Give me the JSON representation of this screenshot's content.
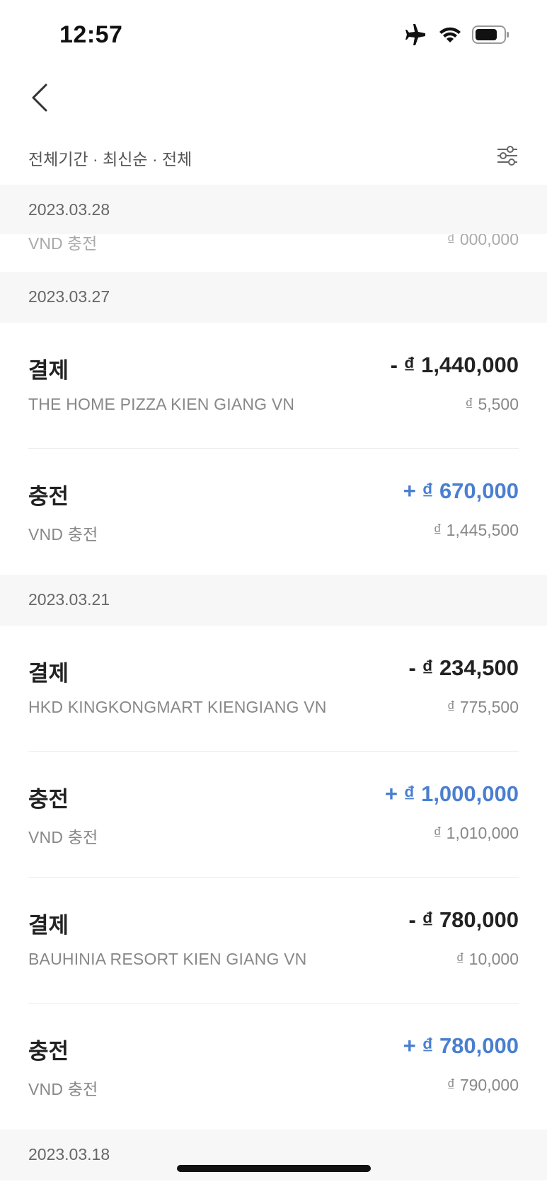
{
  "status_bar": {
    "time": "12:57",
    "icons": [
      "airplane-icon",
      "wifi-icon",
      "battery-icon"
    ]
  },
  "nav": {
    "back_icon": "chevron-left-icon"
  },
  "filter": {
    "label": "전체기간 · 최신순 · 전체",
    "icon": "sliders-icon"
  },
  "sticky_date": "2023.03.28",
  "partial_row": {
    "left": "VND 충전",
    "right": "₫ 000,000"
  },
  "groups": [
    {
      "date": "2023.03.27",
      "transactions": [
        {
          "type": "결제",
          "amount": "- ₫ 1,440,000",
          "direction": "minus",
          "merchant": "THE HOME PIZZA KIEN GIANG VN",
          "balance": "₫ 5,500"
        },
        {
          "type": "충전",
          "amount": "+ ₫ 670,000",
          "direction": "plus",
          "merchant": "VND 충전",
          "balance": "₫ 1,445,500"
        }
      ]
    },
    {
      "date": "2023.03.21",
      "transactions": [
        {
          "type": "결제",
          "amount": "- ₫ 234,500",
          "direction": "minus",
          "merchant": "HKD KINGKONGMART KIENGIANG VN",
          "balance": "₫ 775,500"
        },
        {
          "type": "충전",
          "amount": "+ ₫ 1,000,000",
          "direction": "plus",
          "merchant": "VND 충전",
          "balance": "₫ 1,010,000"
        },
        {
          "type": "결제",
          "amount": "- ₫ 780,000",
          "direction": "minus",
          "merchant": "BAUHINIA RESORT KIEN GIANG VN",
          "balance": "₫ 10,000"
        },
        {
          "type": "충전",
          "amount": "+ ₫ 780,000",
          "direction": "plus",
          "merchant": "VND 충전",
          "balance": "₫ 790,000"
        }
      ]
    },
    {
      "date": "2023.03.18",
      "transactions": []
    }
  ],
  "colors": {
    "plus": "#4a7fd0",
    "minus": "#222222",
    "date_header_bg": "#f7f7f7"
  }
}
